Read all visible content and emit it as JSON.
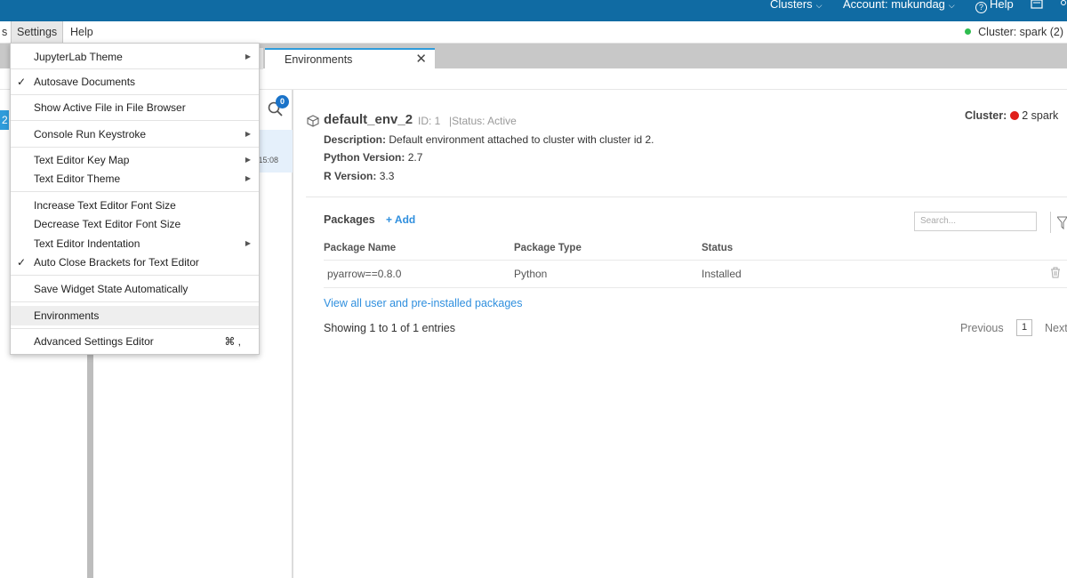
{
  "topbar": {
    "clusters_label": "Clusters",
    "account_label": "Account: mukundag",
    "help_label": "Help"
  },
  "menubar": {
    "partial_left": "s",
    "settings": "Settings",
    "help": "Help",
    "cluster_status": "Cluster: spark (2)"
  },
  "settings_menu": {
    "items": [
      {
        "label": "JupyterLab Theme"
      },
      {
        "label": "Autosave Documents"
      },
      {
        "label": "Show Active File in File Browser"
      },
      {
        "label": "Console Run Keystroke"
      },
      {
        "label": "Text Editor Key Map"
      },
      {
        "label": "Text Editor Theme"
      },
      {
        "label": "Increase Text Editor Font Size"
      },
      {
        "label": "Decrease Text Editor Font Size"
      },
      {
        "label": "Text Editor Indentation"
      },
      {
        "label": "Auto Close Brackets for Text Editor"
      },
      {
        "label": "Save Widget State Automatically"
      },
      {
        "label": "Environments"
      },
      {
        "label": "Advanced Settings Editor",
        "shortcut": "⌘ ,"
      }
    ]
  },
  "tabs": {
    "environments": "Environments"
  },
  "sidebar": {
    "selected_fragment": "2",
    "badge_count": "0",
    "env_time_fragment": "0 15:08"
  },
  "environment": {
    "name": "default_env_2",
    "id_text": "ID: 1",
    "status_text": "|Status: Active",
    "description_label": "Description:",
    "description_value": "Default environment attached to cluster with cluster id 2.",
    "python_label": "Python Version:",
    "python_value": "2.7",
    "r_label": "R Version:",
    "r_value": "3.3",
    "cluster_label": "Cluster:",
    "cluster_value": "2 spark"
  },
  "packages": {
    "title": "Packages",
    "add_label": "+ Add",
    "search_placeholder": "Search...",
    "columns": [
      "Package Name",
      "Package Type",
      "Status"
    ],
    "rows": [
      {
        "name": "pyarrow==0.8.0",
        "type": "Python",
        "status": "Installed"
      }
    ],
    "view_all": "View all user and pre-installed packages",
    "showing": "Showing 1 to 1 of 1 entries",
    "previous": "Previous",
    "page": "1",
    "next": "Next"
  },
  "colors": {
    "topbar": "#106ba3",
    "accent": "#2f9cdb",
    "link": "#2f8fde",
    "cluster_active": "#2ebd4f",
    "cluster_dot": "#e0201b"
  }
}
